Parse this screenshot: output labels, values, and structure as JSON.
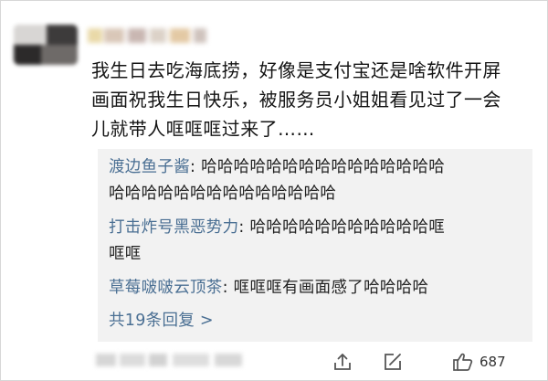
{
  "post": {
    "lines": [
      "我生日去吃海底捞，好像是支付宝还是啥软件开屏",
      "画面祝我生日快乐，被服务员小姐姐看见过了一会",
      "儿就带人哐哐哐过来了……"
    ]
  },
  "replies": [
    {
      "author": "渡边鱼子酱",
      "sep": ": ",
      "line1": "哈哈哈哈哈哈哈哈哈哈哈哈哈哈哈",
      "line2": "哈哈哈哈哈哈哈哈哈哈哈哈哈哈"
    },
    {
      "author": "打击炸号黑恶势力",
      "sep": ": ",
      "line1": "哈哈哈哈哈哈哈哈哈哈哈哐",
      "line2": "哐哐"
    },
    {
      "author": "草莓啵啵云顶茶",
      "sep": ": ",
      "line1": "哐哐哐有画面感了哈哈哈哈"
    }
  ],
  "more_replies": "共19条回复 >",
  "actions": {
    "like_count": "687"
  },
  "colors": {
    "link": "#4a6f93",
    "reply_bg": "#f2f2f2",
    "text": "#151515"
  },
  "icons": {
    "share": "share-icon",
    "comment": "comment-icon",
    "like": "thumbs-up-icon"
  }
}
